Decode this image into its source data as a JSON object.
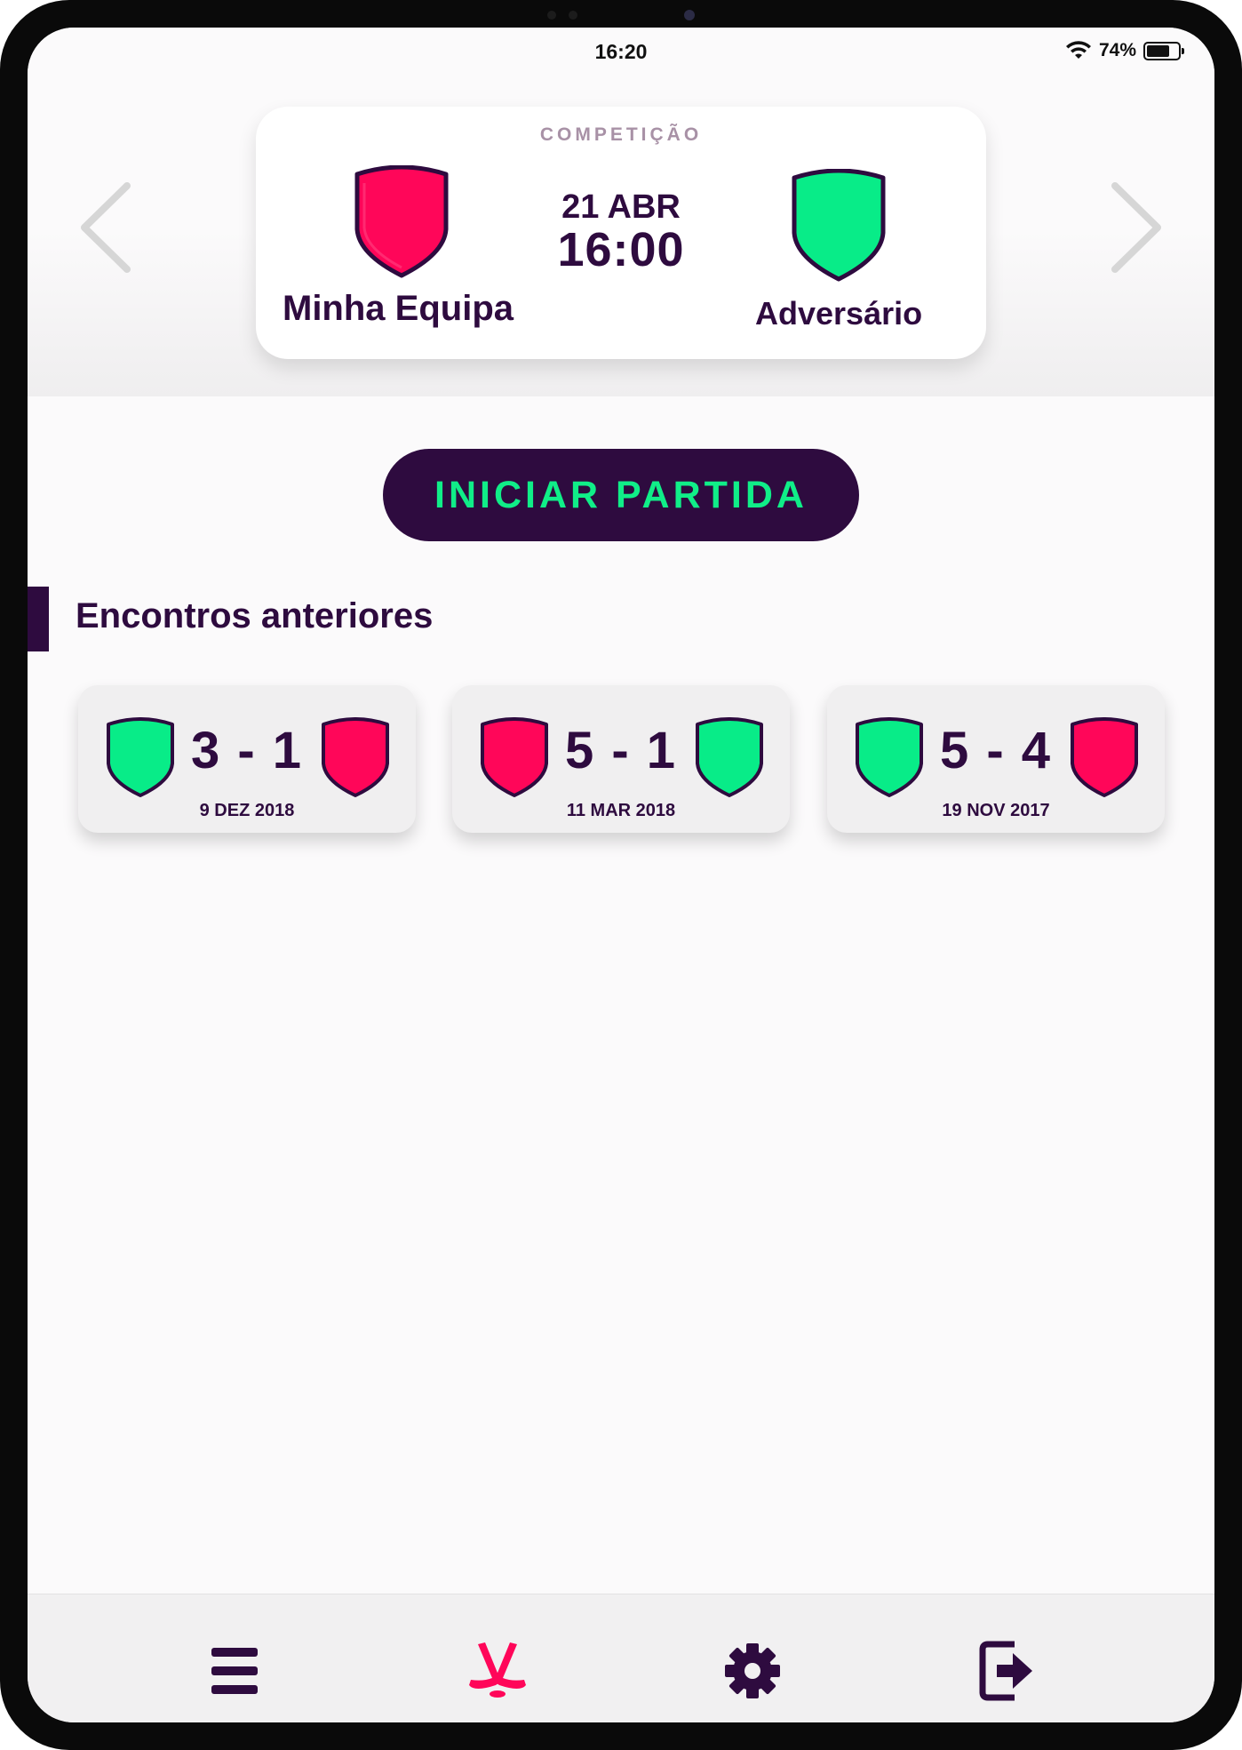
{
  "status_bar": {
    "time": "16:20",
    "battery": "74%"
  },
  "match": {
    "competition": "COMPETIÇÃO",
    "date": "21 ABR",
    "time": "16:00",
    "home_team": "Minha Equipa",
    "away_team": "Adversário",
    "home_color": "#ff0659",
    "away_color": "#08ec88"
  },
  "start_button": "INICIAR PARTIDA",
  "previous_section": {
    "title": "Encontros anteriores",
    "matches": [
      {
        "score": "3 - 1",
        "date": "9 DEZ 2018",
        "left_shield": "green",
        "right_shield": "red"
      },
      {
        "score": "5 - 1",
        "date": "11 MAR 2018",
        "left_shield": "red",
        "right_shield": "green"
      },
      {
        "score": "5 - 4",
        "date": "19 NOV 2017",
        "left_shield": "green",
        "right_shield": "red"
      }
    ]
  },
  "tab_bar": {
    "items": [
      {
        "icon": "menu-icon"
      },
      {
        "icon": "hockey-sticks-icon"
      },
      {
        "icon": "gear-icon"
      },
      {
        "icon": "logout-icon"
      }
    ]
  },
  "colors": {
    "primary": "#2e0b3f",
    "accent": "#10ee88",
    "red": "#ff0659",
    "tab_active": "#ff0659"
  }
}
